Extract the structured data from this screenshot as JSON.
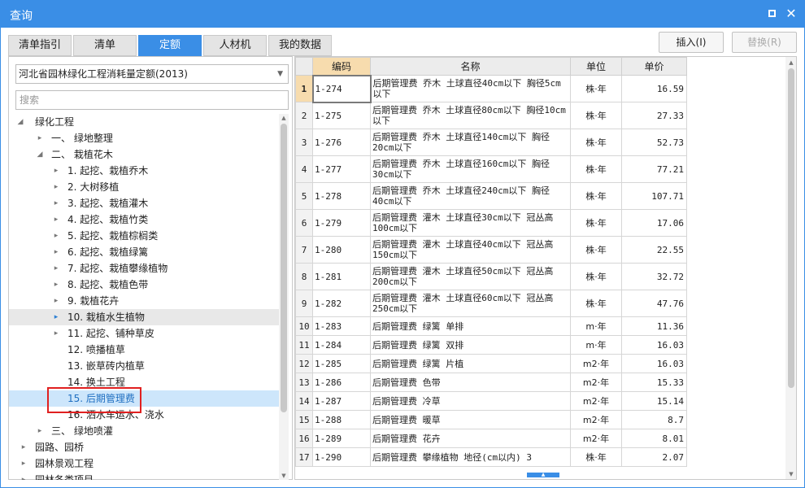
{
  "window": {
    "title": "查询",
    "maximize_icon": "maximize-icon",
    "close_icon": "close-icon",
    "close_glyph": "✕"
  },
  "tabs": [
    {
      "label": "清单指引",
      "active": false
    },
    {
      "label": "清单",
      "active": false
    },
    {
      "label": "定额",
      "active": true
    },
    {
      "label": "人材机",
      "active": false
    },
    {
      "label": "我的数据",
      "active": false
    }
  ],
  "toolbar": {
    "insert_label": "插入(I)",
    "replace_label": "替换(R)"
  },
  "left": {
    "library_select": "河北省园林绿化工程消耗量定额(2013)",
    "search_placeholder": "搜索",
    "tree": [
      {
        "label": "绿化工程",
        "caret": "◢",
        "level": 0
      },
      {
        "label": "一、 绿地整理",
        "caret": "▸",
        "level": 1
      },
      {
        "label": "二、 栽植花木",
        "caret": "◢",
        "level": 1
      },
      {
        "label": "1. 起挖、栽植乔木",
        "caret": "▸",
        "level": 2
      },
      {
        "label": "2. 大树移植",
        "caret": "▸",
        "level": 2
      },
      {
        "label": "3. 起挖、栽植灌木",
        "caret": "▸",
        "level": 2
      },
      {
        "label": "4. 起挖、栽植竹类",
        "caret": "▸",
        "level": 2
      },
      {
        "label": "5. 起挖、栽植棕榈类",
        "caret": "▸",
        "level": 2
      },
      {
        "label": "6. 起挖、栽植绿篱",
        "caret": "▸",
        "level": 2
      },
      {
        "label": "7. 起挖、栽植攀缘植物",
        "caret": "▸",
        "level": 2
      },
      {
        "label": "8. 起挖、栽植色带",
        "caret": "▸",
        "level": 2
      },
      {
        "label": "9. 栽植花卉",
        "caret": "▸",
        "level": 2
      },
      {
        "label": "10. 栽植水生植物",
        "caret": "▸",
        "level": 2
      },
      {
        "label": "11. 起挖、铺种草皮",
        "caret": "▸",
        "level": 2
      },
      {
        "label": "12. 喷播植草",
        "caret": "",
        "level": 2
      },
      {
        "label": "13. 嵌草砖内植草",
        "caret": "",
        "level": 2
      },
      {
        "label": "14. 换土工程",
        "caret": "",
        "level": 2
      },
      {
        "label": "15. 后期管理费",
        "caret": "",
        "level": 2
      },
      {
        "label": "16. 洒水车运水、浇水",
        "caret": "",
        "level": 2
      },
      {
        "label": "三、 绿地喷灌",
        "caret": "▸",
        "level": 1
      },
      {
        "label": "园路、园桥",
        "caret": "▸",
        "level": 0
      },
      {
        "label": "园林景观工程",
        "caret": "▸",
        "level": 0
      },
      {
        "label": "园林各类项目",
        "caret": "▸",
        "level": 0
      }
    ]
  },
  "grid": {
    "headers": {
      "code": "编码",
      "name": "名称",
      "unit": "单位",
      "price": "单价"
    },
    "rows": [
      {
        "n": "1",
        "code": "1-274",
        "name": "后期管理费 乔木 土球直径40cm以下 胸径5cm以下",
        "unit": "株·年",
        "price": "16.59"
      },
      {
        "n": "2",
        "code": "1-275",
        "name": "后期管理费 乔木 土球直径80cm以下 胸径10cm以下",
        "unit": "株·年",
        "price": "27.33"
      },
      {
        "n": "3",
        "code": "1-276",
        "name": "后期管理费 乔木 土球直径140cm以下 胸径20cm以下",
        "unit": "株·年",
        "price": "52.73"
      },
      {
        "n": "4",
        "code": "1-277",
        "name": "后期管理费 乔木 土球直径160cm以下 胸径30cm以下",
        "unit": "株·年",
        "price": "77.21"
      },
      {
        "n": "5",
        "code": "1-278",
        "name": "后期管理费 乔木 土球直径240cm以下 胸径40cm以下",
        "unit": "株·年",
        "price": "107.71"
      },
      {
        "n": "6",
        "code": "1-279",
        "name": "后期管理费 灌木 土球直径30cm以下 冠丛高100cm以下",
        "unit": "株·年",
        "price": "17.06"
      },
      {
        "n": "7",
        "code": "1-280",
        "name": "后期管理费 灌木 土球直径40cm以下 冠丛高150cm以下",
        "unit": "株·年",
        "price": "22.55"
      },
      {
        "n": "8",
        "code": "1-281",
        "name": "后期管理费 灌木 土球直径50cm以下 冠丛高200cm以下",
        "unit": "株·年",
        "price": "32.72"
      },
      {
        "n": "9",
        "code": "1-282",
        "name": "后期管理费 灌木 土球直径60cm以下 冠丛高250cm以下",
        "unit": "株·年",
        "price": "47.76"
      },
      {
        "n": "10",
        "code": "1-283",
        "name": "后期管理费 绿篱 单排",
        "unit": "m·年",
        "price": "11.36"
      },
      {
        "n": "11",
        "code": "1-284",
        "name": "后期管理费 绿篱 双排",
        "unit": "m·年",
        "price": "16.03"
      },
      {
        "n": "12",
        "code": "1-285",
        "name": "后期管理费 绿篱 片植",
        "unit": "m2·年",
        "price": "16.03"
      },
      {
        "n": "13",
        "code": "1-286",
        "name": "后期管理费 色带",
        "unit": "m2·年",
        "price": "15.33"
      },
      {
        "n": "14",
        "code": "1-287",
        "name": "后期管理费 冷草",
        "unit": "m2·年",
        "price": "15.14"
      },
      {
        "n": "15",
        "code": "1-288",
        "name": "后期管理费 暖草",
        "unit": "m2·年",
        "price": "8.7"
      },
      {
        "n": "16",
        "code": "1-289",
        "name": "后期管理费 花卉",
        "unit": "m2·年",
        "price": "8.01"
      },
      {
        "n": "17",
        "code": "1-290",
        "name": "后期管理费 攀缘植物 地径(cm以内) 3",
        "unit": "株·年",
        "price": "2.07"
      }
    ]
  },
  "colors": {
    "accent": "#3a8ee6",
    "selected_header": "#f7dcae",
    "tree_selected": "#cde6fb",
    "highlight": "#e02020"
  }
}
